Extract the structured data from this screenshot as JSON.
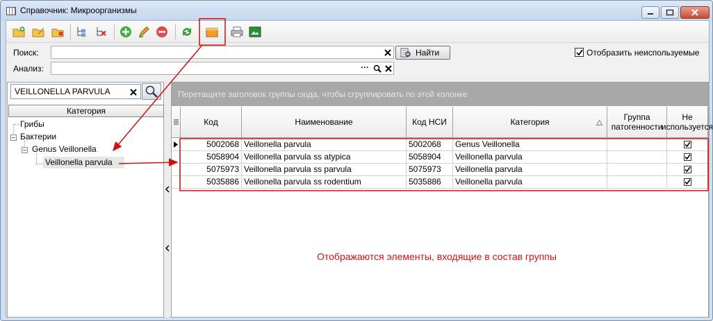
{
  "window": {
    "title": "Справочник: Микроорганизмы"
  },
  "toolbar": {
    "icons": [
      "add-folder-icon",
      "open-folder-icon",
      "delete-folder-icon",
      "add-node-icon",
      "delete-node-icon",
      "add-icon",
      "edit-icon",
      "remove-icon",
      "refresh-icon",
      "group-folder-icon",
      "print-icon",
      "export-icon"
    ]
  },
  "search": {
    "label": "Поиск:",
    "value": "",
    "find_label": "Найти"
  },
  "analysis": {
    "label": "Анализ:",
    "value": "",
    "ellipsis": "···"
  },
  "show_unused": {
    "label": "Отобразить неиспользуемые",
    "checked": true
  },
  "tree_search": {
    "value": "VEILLONELLA PARVULA"
  },
  "tree": {
    "header": "Категория",
    "items": [
      {
        "label": "Грибы"
      },
      {
        "label": "Бактерии"
      },
      {
        "label": "Genus Veillonella"
      },
      {
        "label": "Veillonella parvula"
      }
    ]
  },
  "grid": {
    "group_hint": "Перетащите заголовок группы сюда, чтобы сгруппировать по этой колонке",
    "columns": [
      "Код",
      "Наименование",
      "Код НСИ",
      "Категория",
      "Группа патогенности",
      "Не используется"
    ],
    "rows": [
      {
        "code": "5002068",
        "name": "Veillonella parvula",
        "nsi": "5002068",
        "category": "Genus Veillonella",
        "group": "",
        "unused": true
      },
      {
        "code": "5058904",
        "name": "Veillonella parvula ss atypica",
        "nsi": "5058904",
        "category": "Veillonella parvula",
        "group": "",
        "unused": true
      },
      {
        "code": "5075973",
        "name": "Veillonella parvula ss parvula",
        "nsi": "5075973",
        "category": "Veillonella parvula",
        "group": "",
        "unused": true
      },
      {
        "code": "5035886",
        "name": "Veillonella parvula ss rodentium",
        "nsi": "5035886",
        "category": "Veillonella parvula",
        "group": "",
        "unused": true
      }
    ]
  },
  "annotation": {
    "text": "Отображаются элементы, входящие в состав группы"
  },
  "colors": {
    "highlight": "#cc1111",
    "group_panel": "#a8a8a8",
    "title_bar": "#c4d7ef"
  }
}
